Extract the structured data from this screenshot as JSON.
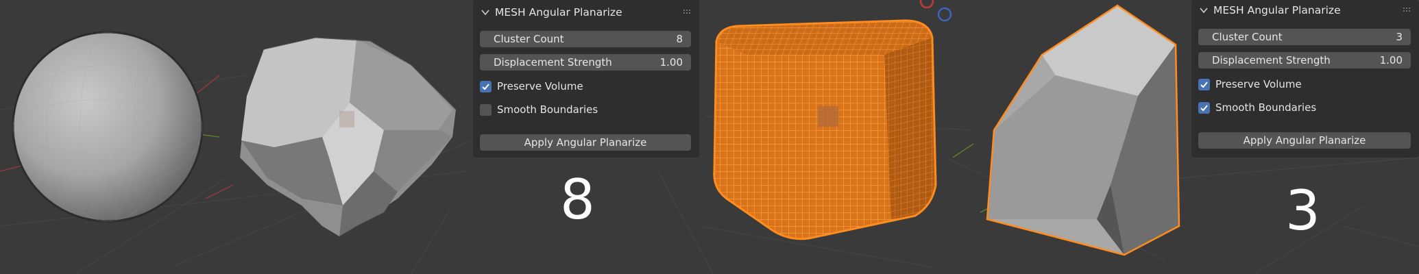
{
  "panels": [
    {
      "title": "MESH Angular Planarize",
      "cluster_label": "Cluster Count",
      "cluster_value": "8",
      "disp_label": "Displacement Strength",
      "disp_value": "1.00",
      "preserve_label": "Preserve Volume",
      "preserve_checked": true,
      "smooth_label": "Smooth Boundaries",
      "smooth_checked": false,
      "apply_label": "Apply Angular Planarize"
    },
    {
      "title": "MESH Angular Planarize",
      "cluster_label": "Cluster Count",
      "cluster_value": "3",
      "disp_label": "Displacement Strength",
      "disp_value": "1.00",
      "preserve_label": "Preserve Volume",
      "preserve_checked": true,
      "smooth_label": "Smooth Boundaries",
      "smooth_checked": true,
      "apply_label": "Apply Angular Planarize"
    }
  ],
  "big_numbers": [
    "8",
    "3"
  ],
  "colors": {
    "viewport_bg": "#3a3a3a",
    "panel_bg": "#2e2e2e",
    "field_bg": "#545454",
    "checkbox_on": "#4772b3",
    "selection_orange": "#f08a24"
  }
}
